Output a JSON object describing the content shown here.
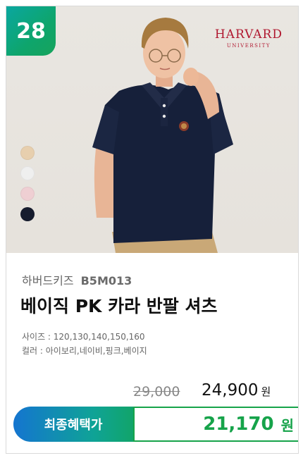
{
  "rank": "28",
  "brand_logo": {
    "name": "HARVARD",
    "sub": "UNIVERSITY",
    "color": "#b0182f"
  },
  "swatches": [
    {
      "name": "아이보리",
      "color": "#e7cfae"
    },
    {
      "name": "흰색",
      "color": "#efefef"
    },
    {
      "name": "핑크",
      "color": "#efcfd3"
    },
    {
      "name": "네이비",
      "color": "#161c2e"
    }
  ],
  "product": {
    "brand": "하버드키즈",
    "code": "B5M013",
    "title": "베이직 PK 카라 반팔 셔츠",
    "sizes": "사이즈 : 120,130,140,150,160",
    "colors": "컬러 : 아이보리,네이비,핑크,베이지"
  },
  "price": {
    "original": "29,000",
    "sale": "24,900",
    "sale_unit": "원",
    "final_label": "최종혜택가",
    "final": "21,170",
    "final_unit": "원",
    "accent": "#16a34a"
  }
}
